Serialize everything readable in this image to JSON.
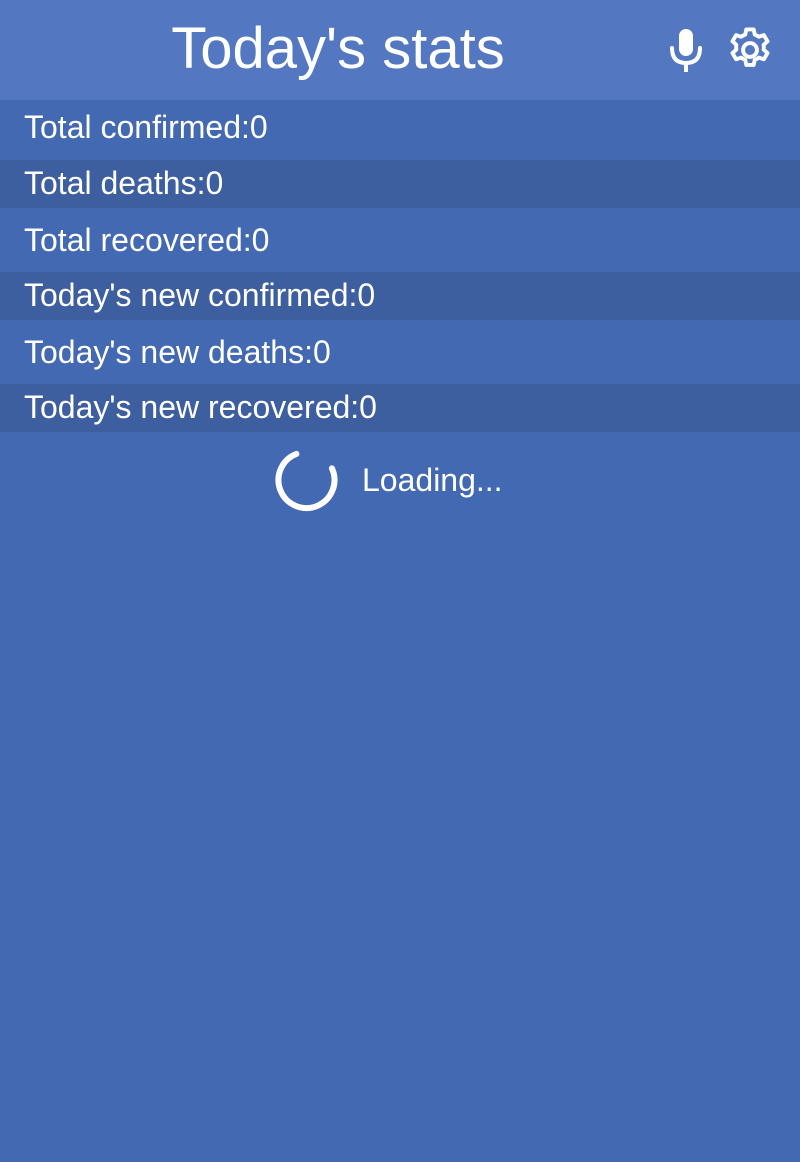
{
  "header": {
    "title": "Today's stats",
    "icons": {
      "microphone": "microphone-icon",
      "settings": "gear-icon"
    }
  },
  "stats": [
    {
      "label": "Total confirmed:0"
    },
    {
      "label": "Total deaths:0"
    },
    {
      "label": "Total recovered:0"
    },
    {
      "label": "Today's new confirmed:0"
    },
    {
      "label": "Today's new deaths:0"
    },
    {
      "label": "Today's new recovered:0"
    }
  ],
  "loading": {
    "text": "Loading..."
  },
  "colors": {
    "background": "#4369b2",
    "header": "#5378c1",
    "row_alt": "#3d5fa0",
    "text": "#ffffff"
  }
}
